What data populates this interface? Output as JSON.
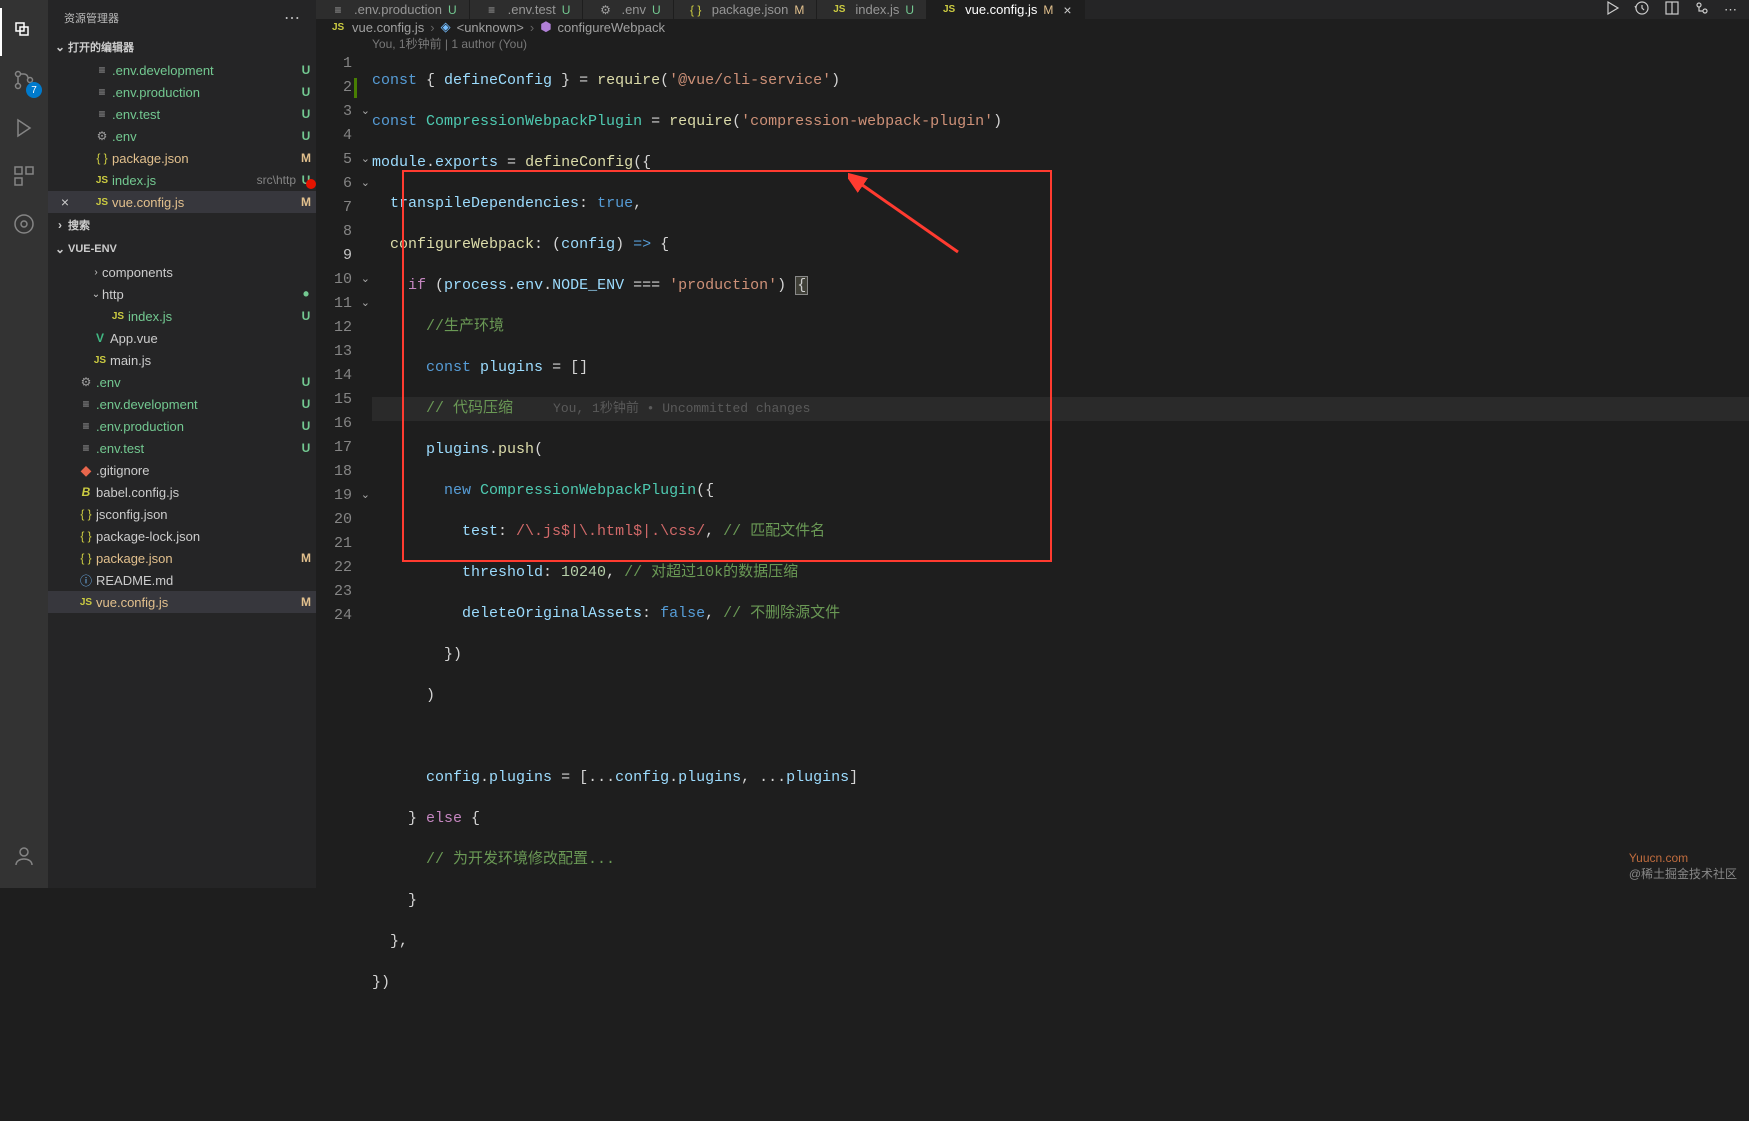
{
  "sidebar": {
    "title": "资源管理器",
    "sections": {
      "openEditors": "打开的编辑器",
      "search": "搜索",
      "workspace": "VUE-ENV"
    },
    "openEditors": [
      {
        "icon": "env",
        "label": ".env.development",
        "status": "U"
      },
      {
        "icon": "env",
        "label": ".env.production",
        "status": "U"
      },
      {
        "icon": "env",
        "label": ".env.test",
        "status": "U"
      },
      {
        "icon": "gear",
        "label": ".env",
        "status": "U"
      },
      {
        "icon": "json",
        "label": "package.json",
        "status": "M"
      },
      {
        "icon": "js",
        "label": "index.js",
        "hint": "src\\http",
        "status": "U"
      },
      {
        "icon": "js",
        "label": "vue.config.js",
        "status": "M",
        "active": true,
        "close": true
      }
    ],
    "tree": [
      {
        "type": "folder",
        "label": "components",
        "chev": ">",
        "indent": 20
      },
      {
        "type": "folder",
        "label": "http",
        "chev": "v",
        "indent": 20,
        "dot": true
      },
      {
        "type": "file",
        "icon": "js",
        "label": "index.js",
        "status": "U",
        "indent": 38,
        "cls": "row-U"
      },
      {
        "type": "file",
        "icon": "vue",
        "label": "App.vue",
        "indent": 20
      },
      {
        "type": "file",
        "icon": "js",
        "label": "main.js",
        "indent": 20
      },
      {
        "type": "file",
        "icon": "gear",
        "label": ".env",
        "status": "U",
        "indent": 6,
        "cls": "row-U"
      },
      {
        "type": "file",
        "icon": "env",
        "label": ".env.development",
        "status": "U",
        "indent": 6,
        "cls": "row-U"
      },
      {
        "type": "file",
        "icon": "env",
        "label": ".env.production",
        "status": "U",
        "indent": 6,
        "cls": "row-U"
      },
      {
        "type": "file",
        "icon": "env",
        "label": ".env.test",
        "status": "U",
        "indent": 6,
        "cls": "row-U"
      },
      {
        "type": "file",
        "icon": "git",
        "label": ".gitignore",
        "indent": 6
      },
      {
        "type": "file",
        "icon": "babel",
        "label": "babel.config.js",
        "indent": 6
      },
      {
        "type": "file",
        "icon": "json",
        "label": "jsconfig.json",
        "indent": 6
      },
      {
        "type": "file",
        "icon": "json",
        "label": "package-lock.json",
        "indent": 6
      },
      {
        "type": "file",
        "icon": "json",
        "label": "package.json",
        "status": "M",
        "indent": 6,
        "cls": "row-M"
      },
      {
        "type": "file",
        "icon": "info",
        "label": "README.md",
        "indent": 6
      },
      {
        "type": "file",
        "icon": "js",
        "label": "vue.config.js",
        "status": "M",
        "indent": 6,
        "cls": "row-M",
        "active": true
      }
    ]
  },
  "activity": {
    "scmBadge": "7"
  },
  "tabs": [
    {
      "icon": "env",
      "label": ".env.production",
      "status": "U",
      "active": false
    },
    {
      "icon": "env",
      "label": ".env.test",
      "status": "U",
      "active": false
    },
    {
      "icon": "gear",
      "label": ".env",
      "status": "U",
      "active": false
    },
    {
      "icon": "json",
      "label": "package.json",
      "status": "M",
      "active": false
    },
    {
      "icon": "js",
      "label": "index.js",
      "status": "U",
      "active": false
    },
    {
      "icon": "js",
      "label": "vue.config.js",
      "status": "M",
      "active": true,
      "close": true
    }
  ],
  "breadcrumb": {
    "file": "vue.config.js",
    "item1": "<unknown>",
    "item2": "configureWebpack"
  },
  "gitlens": "You, 1秒钟前 | 1 author (You)",
  "gitlensInline": "You, 1秒钟前 • Uncommitted changes",
  "code": {
    "l1a": "const",
    "l1b": " { ",
    "l1c": "defineConfig",
    "l1d": " } = ",
    "l1e": "require",
    "l1f": "(",
    "l1g": "'@vue/cli-service'",
    "l1h": ")",
    "l2a": "const",
    "l2b": " ",
    "l2c": "CompressionWebpackPlugin",
    "l2d": " = ",
    "l2e": "require",
    "l2f": "(",
    "l2g": "'compression-webpack-plugin'",
    "l2h": ")",
    "l3a": "module",
    "l3b": ".",
    "l3c": "exports",
    "l3d": " = ",
    "l3e": "defineConfig",
    "l3f": "({",
    "l4a": "  ",
    "l4b": "transpileDependencies",
    "l4c": ": ",
    "l4d": "true",
    "l4e": ",",
    "l5a": "  ",
    "l5b": "configureWebpack",
    "l5c": ": (",
    "l5d": "config",
    "l5e": ") ",
    "l5f": "=>",
    "l5g": " {",
    "l6a": "    ",
    "l6b": "if",
    "l6c": " (",
    "l6d": "process",
    "l6e": ".",
    "l6f": "env",
    "l6g": ".",
    "l6h": "NODE_ENV",
    "l6i": " === ",
    "l6j": "'production'",
    "l6k": ") ",
    "l6l": "{",
    "l7": "      //生产环境",
    "l8a": "      ",
    "l8b": "const",
    "l8c": " ",
    "l8d": "plugins",
    "l8e": " = []",
    "l9a": "      ",
    "l9b": "// 代码压缩",
    "l10a": "      ",
    "l10b": "plugins",
    "l10c": ".",
    "l10d": "push",
    "l10e": "(",
    "l11a": "        ",
    "l11b": "new",
    "l11c": " ",
    "l11d": "CompressionWebpackPlugin",
    "l11e": "({",
    "l12a": "          ",
    "l12b": "test",
    "l12c": ": ",
    "l12d": "/\\.js$|\\.html$|.\\css/",
    "l12e": ", ",
    "l12f": "// 匹配文件名",
    "l13a": "          ",
    "l13b": "threshold",
    "l13c": ": ",
    "l13d": "10240",
    "l13e": ", ",
    "l13f": "// 对超过10k的数据压缩",
    "l14a": "          ",
    "l14b": "deleteOriginalAssets",
    "l14c": ": ",
    "l14d": "false",
    "l14e": ", ",
    "l14f": "// 不删除源文件",
    "l15": "        })",
    "l16": "      )",
    "l17": "",
    "l18a": "      ",
    "l18b": "config",
    "l18c": ".",
    "l18d": "plugins",
    "l18e": " = [...",
    "l18f": "config",
    "l18g": ".",
    "l18h": "plugins",
    "l18i": ", ...",
    "l18j": "plugins",
    "l18k": "]",
    "l19a": "    } ",
    "l19b": "else",
    "l19c": " {",
    "l20": "      // 为开发环境修改配置...",
    "l21": "    }",
    "l22": "  },",
    "l23": "})",
    "l24": ""
  },
  "watermark": {
    "brand": "Yuucn.com",
    "sub": "@稀土掘金技术社区"
  }
}
